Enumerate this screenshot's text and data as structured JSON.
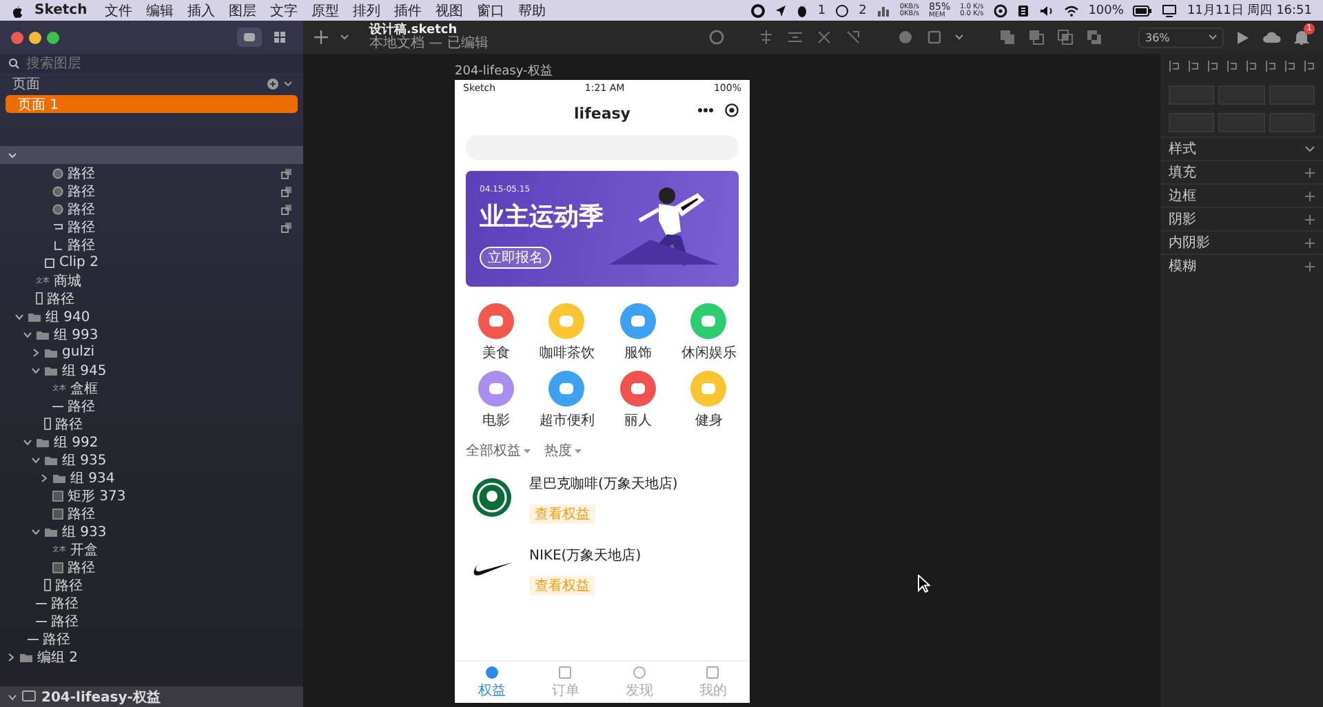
{
  "menubar": {
    "app": "Sketch",
    "menus": [
      "文件",
      "编辑",
      "插入",
      "图层",
      "文字",
      "原型",
      "排列",
      "插件",
      "视图",
      "窗口",
      "帮助"
    ],
    "status": {
      "qq_count": "1",
      "chat_count": "2",
      "net_up": "0KB/s",
      "net_down": "0KB/s",
      "mem": "85%",
      "mem_label": "MEM",
      "speed_up": "1.0 K/s",
      "speed_down": "0.0 K/s",
      "battery": "100%",
      "datetime": "11月11日 周四 16:51"
    }
  },
  "toolbar": {
    "title": "设计稿.sketch",
    "subtitle": "本地文档 — 已编辑",
    "zoom": "36%",
    "notifications": "1"
  },
  "sidebar": {
    "search_placeholder": "搜索图层",
    "pages_label": "页面",
    "pages": [
      {
        "name": "页面 1",
        "selected": true
      }
    ],
    "layers": [
      {
        "children": [
          {
            "children": [
              {
                "children": [
                  {
                    "children": [
                      {
                        "name": "路径",
                        "kind": "oval",
                        "linked": true
                      },
                      {
                        "name": "路径",
                        "kind": "oval",
                        "linked": true
                      },
                      {
                        "name": "路径",
                        "kind": "oval",
                        "linked": true
                      },
                      {
                        "name": "路径",
                        "kind": "path",
                        "linked": true
                      },
                      {
                        "name": "路径",
                        "kind": "corner",
                        "linked": false
                      }
                    ]
                  },
                  {
                    "name": "Clip 2",
                    "kind": "square",
                    "linked": false
                  }
                ]
              },
              {
                "name": "商城",
                "kind": "text",
                "badge": "文本",
                "linked": false
              },
              {
                "name": "路径",
                "kind": "bar",
                "linked": false
              }
            ]
          },
          {
            "name": "组 940",
            "kind": "folder",
            "expanded": true,
            "linked": false,
            "children": [
              {
                "name": "组 993",
                "kind": "folder",
                "expanded": true,
                "linked": false,
                "children": [
                  {
                    "name": "gulzi",
                    "kind": "folder",
                    "expanded": false,
                    "linked": false
                  },
                  {
                    "name": "组 945",
                    "kind": "folder",
                    "expanded": true,
                    "linked": false,
                    "children": [
                      {
                        "name": "盒框",
                        "kind": "text",
                        "badge": "文本",
                        "linked": false
                      },
                      {
                        "name": "路径",
                        "kind": "line",
                        "linked": false
                      }
                    ]
                  },
                  {
                    "name": "路径",
                    "kind": "bar",
                    "linked": false
                  }
                ]
              },
              {
                "name": "组 992",
                "kind": "folder",
                "expanded": true,
                "linked": false,
                "children": [
                  {
                    "name": "组 935",
                    "kind": "folder",
                    "expanded": true,
                    "linked": false,
                    "children": [
                      {
                        "name": "组 934",
                        "kind": "folder",
                        "expanded": false,
                        "linked": false
                      },
                      {
                        "name": "矩形 373",
                        "kind": "rect",
                        "linked": false
                      },
                      {
                        "name": "路径",
                        "kind": "rect",
                        "linked": false
                      }
                    ]
                  },
                  {
                    "name": "组 933",
                    "kind": "folder",
                    "expanded": true,
                    "linked": false,
                    "children": [
                      {
                        "name": "开盒",
                        "kind": "text",
                        "badge": "文本",
                        "linked": false
                      },
                      {
                        "name": "路径",
                        "kind": "rect",
                        "linked": false
                      }
                    ]
                  },
                  {
                    "name": "路径",
                    "kind": "bar",
                    "linked": false
                  }
                ]
              },
              {
                "name": "路径",
                "kind": "line",
                "linked": false
              },
              {
                "name": "路径",
                "kind": "line",
                "linked": false
              }
            ]
          },
          {
            "name": "路径",
            "kind": "line",
            "linked": false
          }
        ]
      },
      {
        "name": "编组 2",
        "kind": "folder",
        "expanded": false,
        "linked": false
      }
    ],
    "artboard": {
      "name": "204-lifeasy-权益",
      "expanded": true
    }
  },
  "canvas": {
    "artboard_label": "204-lifeasy-权益",
    "phone": {
      "status": {
        "carrier": "Sketch",
        "time": "1:21 AM",
        "battery": "100%"
      },
      "title": "lifeasy",
      "banner": {
        "date": "04.15-05.15",
        "headline": "业主运动季",
        "button": "立即报名"
      },
      "categories": [
        {
          "label": "美食",
          "color": "#f0594c"
        },
        {
          "label": "咖啡茶饮",
          "color": "#fbc531"
        },
        {
          "label": "服饰",
          "color": "#3fa2f0"
        },
        {
          "label": "休闲娱乐",
          "color": "#2ecc71"
        },
        {
          "label": "电影",
          "color": "#a98ef0"
        },
        {
          "label": "超市便利",
          "color": "#3fa2f0"
        },
        {
          "label": "丽人",
          "color": "#ef5350"
        },
        {
          "label": "健身",
          "color": "#fbc531"
        }
      ],
      "filters": [
        "全部权益",
        "热度"
      ],
      "stores": [
        {
          "name": "星巴克咖啡(万象天地店)",
          "tag": "查看权益",
          "kind": "round"
        },
        {
          "name": "NIKE(万象天地店)",
          "tag": "查看权益",
          "kind": "swoosh"
        }
      ],
      "tabs": [
        {
          "label": "权益",
          "selected": true
        },
        {
          "label": "订单",
          "selected": false
        },
        {
          "label": "发现",
          "selected": false
        },
        {
          "label": "我的",
          "selected": false
        }
      ]
    }
  },
  "inspector": {
    "sections": [
      {
        "label": "样式",
        "kind": "collapsible"
      },
      {
        "label": "填充",
        "kind": "add"
      },
      {
        "label": "边框",
        "kind": "add"
      },
      {
        "label": "阴影",
        "kind": "add"
      },
      {
        "label": "内阴影",
        "kind": "add"
      },
      {
        "label": "模糊",
        "kind": "add"
      }
    ]
  }
}
